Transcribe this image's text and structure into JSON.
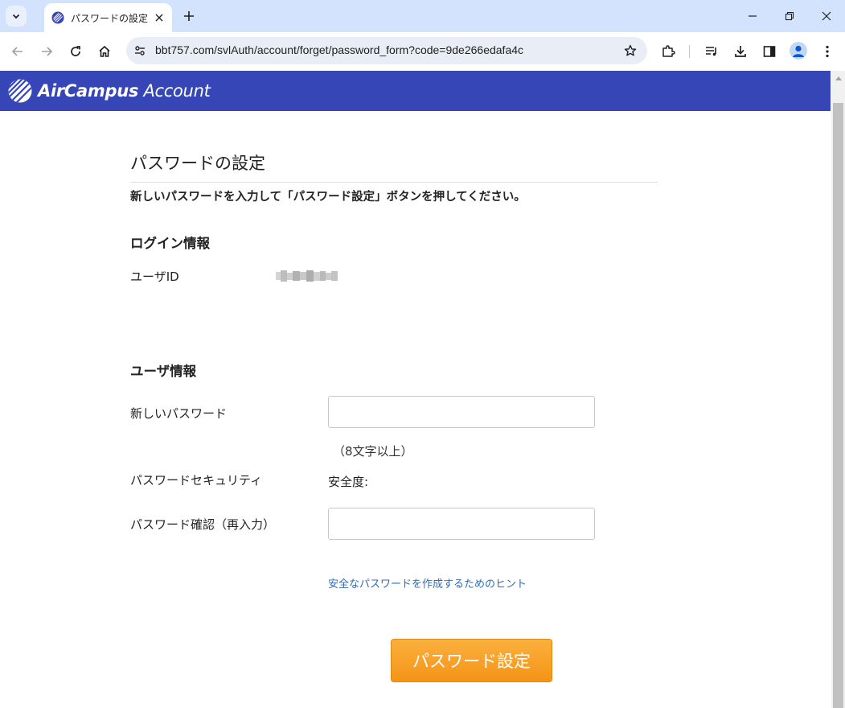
{
  "browser": {
    "tab_title": "パスワードの設定",
    "url": "bbt757.com/svlAuth/account/forget/password_form?code=9de266edafa4c"
  },
  "header": {
    "logo_bold": "AirCampus",
    "logo_light": "Account",
    "brand_color": "#3746b7"
  },
  "page": {
    "title": "パスワードの設定",
    "instruction": "新しいパスワードを入力して「パスワード設定」ボタンを押してください。"
  },
  "login_info": {
    "heading": "ログイン情報",
    "userid_label": "ユーザID"
  },
  "user_info": {
    "heading": "ユーザ情報",
    "new_password_label": "新しいパスワード",
    "new_password_value": "",
    "length_hint": "（8文字以上）",
    "security_label": "パスワードセキュリティ",
    "security_value": "安全度:",
    "confirm_label": "パスワード確認（再入力）",
    "confirm_value": "",
    "tips_link": "安全なパスワードを作成するためのヒント"
  },
  "actions": {
    "submit_label": "パスワード設定",
    "submit_color": "#f7a12a"
  }
}
